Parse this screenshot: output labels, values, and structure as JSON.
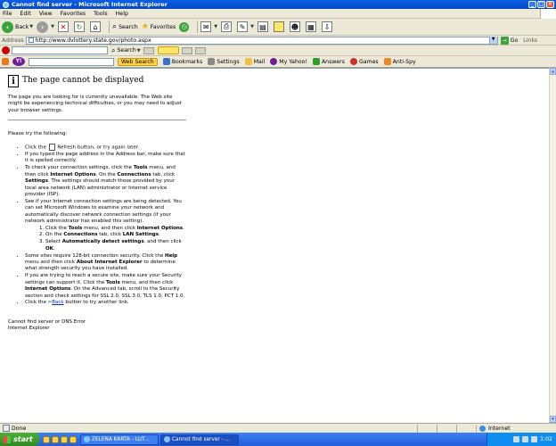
{
  "window": {
    "title": "Cannot find server - Microsoft Internet Explorer",
    "min_glyph": "_",
    "max_glyph": "□",
    "close_glyph": "×"
  },
  "menu": [
    "File",
    "Edit",
    "View",
    "Favorites",
    "Tools",
    "Help"
  ],
  "toolbar": {
    "back_label": "Back",
    "search_label": "Search",
    "favorites_label": "Favorites"
  },
  "address": {
    "label": "Address",
    "url": "http://www.dvlottery.state.gov/photo.aspx",
    "go_label": "Go",
    "links_label": "Links"
  },
  "google_bar": {
    "search_label": "Search"
  },
  "yahoo_bar": {
    "logo_text": "Y!",
    "search_button": "Web Search",
    "items": [
      "Bookmarks",
      "Settings",
      "Mail",
      "My Yahoo!",
      "Answers",
      "Games",
      "Anti-Spy"
    ]
  },
  "page": {
    "title": "The page cannot be displayed",
    "intro": "The page you are looking for is currently unavailable. The Web site might be experiencing technical difficulties, or you may need to adjust your browser settings.",
    "try_heading": "Please try the following:",
    "steps": {
      "refresh_pre": "Click the",
      "refresh_post": "Refresh button, or try again later.",
      "typed": "If you typed the page address in the Address bar, make sure that it is spelled correctly.",
      "conn_1": "To check your connection settings, click the ",
      "conn_tools": "Tools",
      "conn_2": " menu, and then click ",
      "conn_options": "Internet Options",
      "conn_3": ". On the ",
      "conn_tab": "Connections",
      "conn_4": " tab, click ",
      "conn_settings": "Settings",
      "conn_5": ". The settings should match those provided by your local area network (LAN) administrator or Internet service provider (ISP).",
      "detect": "See if your Internet connection settings are being detected. You can set Microsoft Windows to examine your network and automatically discover network connection settings (if your network administrator has enabled this setting).",
      "sub1_pre": "Click the ",
      "sub1_tools": "Tools",
      "sub1_mid": " menu, and then click ",
      "sub1_options": "Internet Options",
      "sub1_end": ".",
      "sub2_pre": "On the ",
      "sub2_conn": "Connections",
      "sub2_mid": " tab, click ",
      "sub2_lan": "LAN Settings",
      "sub2_end": ".",
      "sub3_pre": "Select ",
      "sub3_auto": "Automatically detect settings",
      "sub3_mid": ", and then click ",
      "sub3_ok": "OK",
      "sub3_end": ".",
      "sec_1": "Some sites require 128-bit connection security. Click the ",
      "sec_help": "Help",
      "sec_2": " menu and then click ",
      "sec_about": "About Internet Explorer",
      "sec_3": " to determine what strength security you have installed.",
      "secure_1": "If you are trying to reach a secure site, make sure your Security settings can support it. Click the ",
      "secure_tools": "Tools",
      "secure_2": " menu, and then click ",
      "secure_options": "Internet Options",
      "secure_3": ". On the Advanced tab, scroll to the Security section and check settings for SSL 2.0, SSL 3.0, TLS 1.0, PCT 1.0.",
      "back_pre": "Click the",
      "back_link": "Back",
      "back_post": " button to try another link."
    },
    "footer_error": "Cannot find server or DNS Error",
    "footer_app": "Internet Explorer"
  },
  "status": {
    "text": "Done",
    "zone": "Internet"
  },
  "taskbar": {
    "start_label": "start",
    "tasks": [
      "ZELENA KARTA - LUT...",
      "Cannot find server - ..."
    ],
    "clock": "1:02"
  }
}
